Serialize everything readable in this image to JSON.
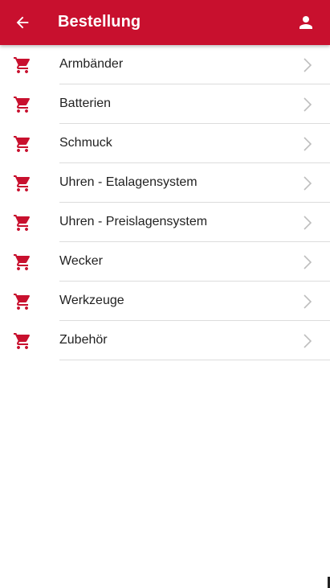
{
  "colors": {
    "accent": "#c8102e",
    "text": "#222222",
    "divider": "#dcdcdc",
    "chevron": "#bdbdbd"
  },
  "appbar": {
    "title": "Bestellung",
    "back_icon": "arrow-left-icon",
    "profile_icon": "person-icon"
  },
  "list": {
    "item_icon": "shopping-cart-icon",
    "items": [
      {
        "label": "Armbänder"
      },
      {
        "label": "Batterien"
      },
      {
        "label": "Schmuck"
      },
      {
        "label": "Uhren - Etalagensystem"
      },
      {
        "label": "Uhren - Preislagensystem"
      },
      {
        "label": "Wecker"
      },
      {
        "label": "Werkzeuge"
      },
      {
        "label": "Zubehör"
      }
    ]
  }
}
